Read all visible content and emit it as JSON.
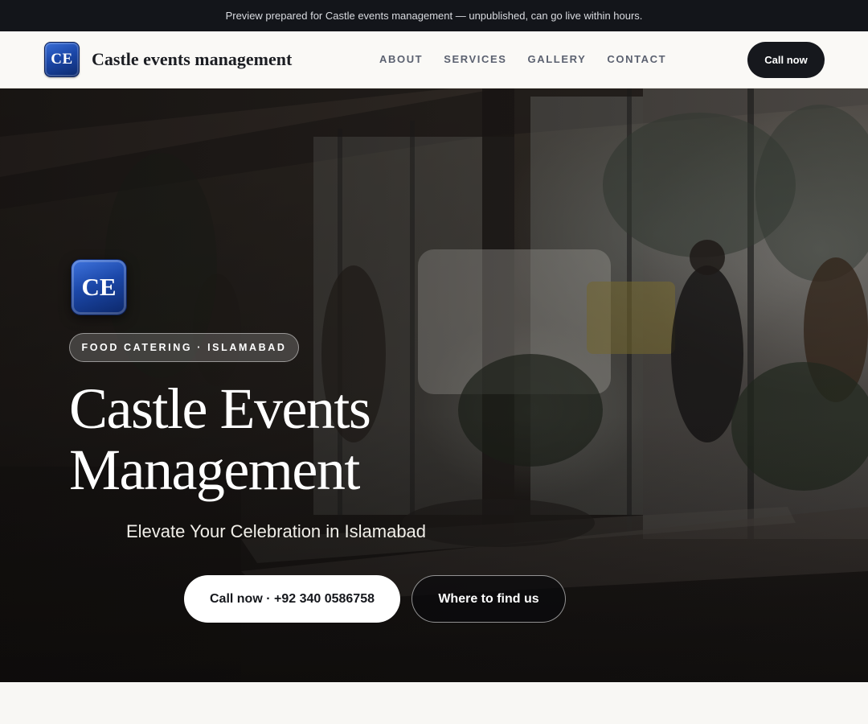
{
  "topbar": {
    "notice": "Preview prepared for Castle events management — unpublished, can go live within hours."
  },
  "navbar": {
    "logo_text": "CE",
    "brand_name": "Castle events management",
    "links": [
      "ABOUT",
      "SERVICES",
      "GALLERY",
      "CONTACT"
    ],
    "cta_label": "Call now"
  },
  "hero": {
    "logo_text": "CE",
    "badge": "FOOD CATERING · ISLAMABAD",
    "title_line1": "Castle Events",
    "title_line2": "Management",
    "subtitle": "Elevate Your Celebration in Islamabad",
    "primary_button": "Call now · +92 340 0586758",
    "secondary_button": "Where to find us",
    "background_image": "restaurant-interior-photo"
  },
  "colors": {
    "topbar_bg": "#13151a",
    "nav_bg": "#faf9f6",
    "cta_dark": "#16181d",
    "logo_blue": "#1b47a8",
    "nav_link": "#5b6170"
  }
}
